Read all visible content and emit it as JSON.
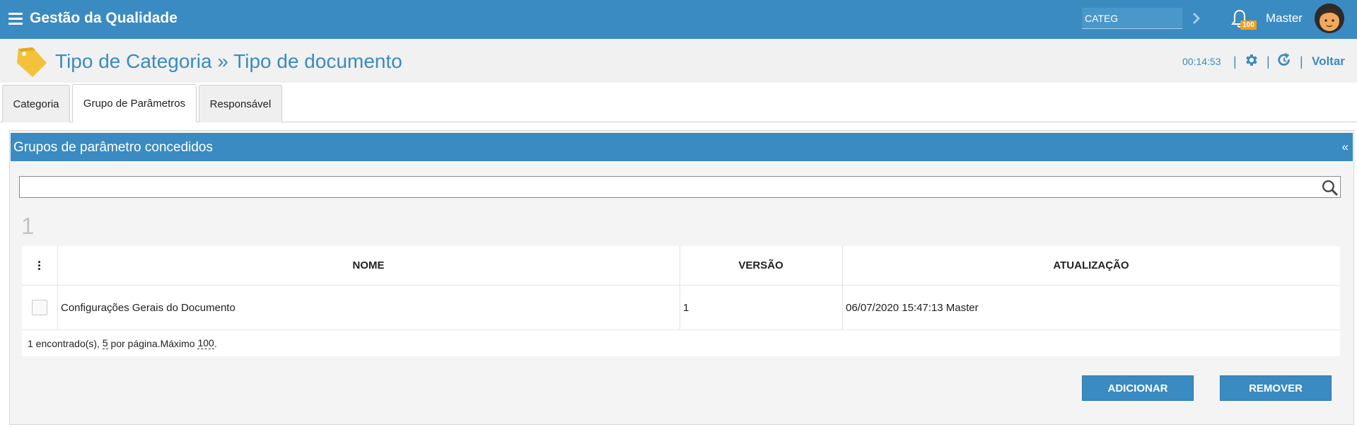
{
  "header": {
    "app_title": "Gestão da Qualidade",
    "search_value": "CATEG",
    "notifications_count": "100",
    "user_name": "Master"
  },
  "titlebar": {
    "title": "Tipo de Categoria » Tipo de documento",
    "timer": "00:14:53",
    "back_label": "Voltar"
  },
  "tabs": [
    {
      "label": "Categoria",
      "active": false
    },
    {
      "label": "Grupo de Parâmetros",
      "active": true
    },
    {
      "label": "Responsável",
      "active": false
    }
  ],
  "panel": {
    "title": "Grupos de parâmetro concedidos",
    "collapse_glyph": "«",
    "filter_value": "",
    "count": "1"
  },
  "table": {
    "columns": [
      "NOME",
      "VERSÃO",
      "ATUALIZAÇÃO"
    ],
    "rows": [
      {
        "nome": "Configurações Gerais do Documento",
        "versao": "1",
        "atualizacao": "06/07/2020 15:47:13 Master"
      }
    ],
    "footer": {
      "found": "1 encontrado(s),",
      "per_page": "5",
      "per_page_suffix": "por página.Máximo",
      "max": "100",
      "end": "."
    }
  },
  "actions": {
    "add_label": "ADICIONAR",
    "remove_label": "REMOVER"
  },
  "colors": {
    "primary": "#3a8bc1",
    "badge": "#f1a01a"
  }
}
